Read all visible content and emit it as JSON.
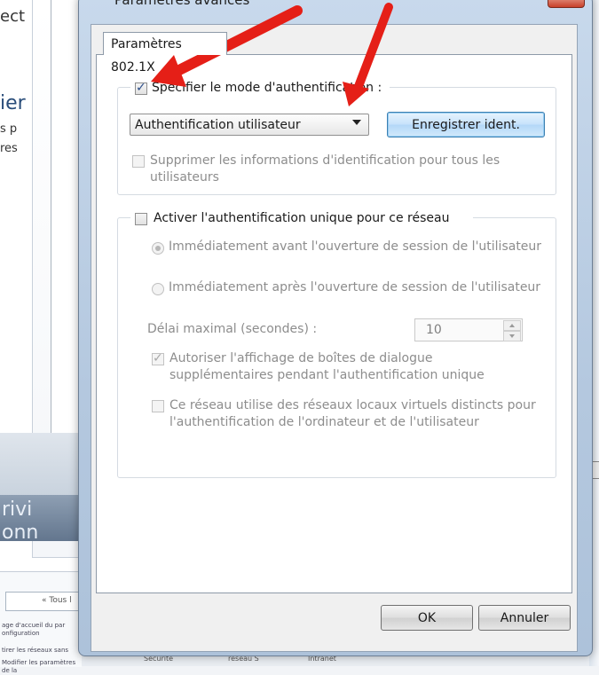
{
  "background": {
    "left_fragments": [
      "ect",
      "ier",
      "s p",
      "res"
    ],
    "dark_fragments": [
      "rivi",
      "onn"
    ],
    "explorer_address": "« Tous l",
    "explorer_nav": [
      "age d'accueil du par",
      "onfiguration",
      "tirer les réseaux sans",
      "Modifier les paramètres de la"
    ],
    "bottom_fragments": [
      "Sécurité",
      "réseau S",
      "Intranet"
    ]
  },
  "dialog": {
    "title": "Paramètres avancés",
    "tab": "Paramètres 802.1X",
    "auth_mode": {
      "checkbox_label": "Spécifier le mode d'authentification :",
      "checked": true,
      "select_value": "Authentification utilisateur",
      "save_button": "Enregistrer ident.",
      "delete_label_line1": "Supprimer les informations d'identification pour tous les",
      "delete_label_line2": "utilisateurs",
      "delete_checked": false
    },
    "sso": {
      "checkbox_label": "Activer l'authentification unique pour ce réseau",
      "checked": false,
      "radio_before": "Immédiatement avant l'ouverture de session de l'utilisateur",
      "radio_after": "Immédiatement après l'ouverture de session de l'utilisateur",
      "delay_label": "Délai maximal (secondes) :",
      "delay_value": "10",
      "allow_dialogs_line1": "Autoriser l'affichage de boîtes de dialogue",
      "allow_dialogs_line2": "supplémentaires pendant l'authentification unique",
      "allow_dialogs_checked": true,
      "vlan_line1": "Ce réseau utilise des réseaux locaux virtuels distincts pour",
      "vlan_line2": "l'authentification de l'ordinateur et de l'utilisateur",
      "vlan_checked": false
    },
    "ok_button": "OK",
    "cancel_button": "Annuler"
  },
  "colors": {
    "annotation_arrow": "#e51f17",
    "focus_button": "#3c7fb1"
  }
}
